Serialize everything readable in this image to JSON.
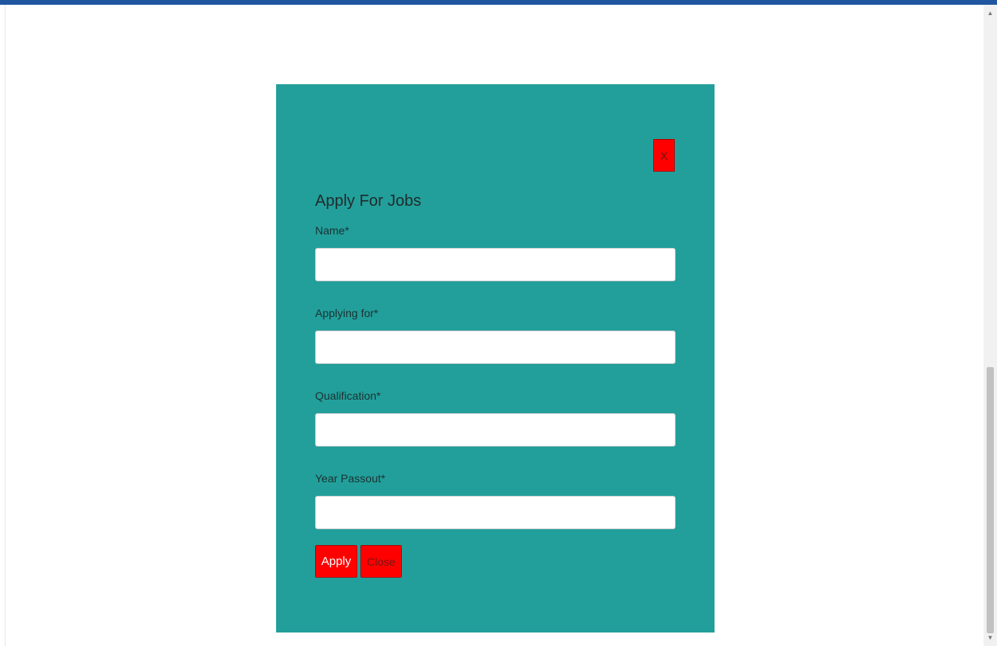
{
  "modal": {
    "close_icon_label": "X",
    "title": "Apply For Jobs",
    "fields": [
      {
        "label": "Name*",
        "value": "",
        "placeholder": ""
      },
      {
        "label": "Applying for*",
        "value": "",
        "placeholder": ""
      },
      {
        "label": "Qualification*",
        "value": "",
        "placeholder": ""
      },
      {
        "label": "Year Passout*",
        "value": "",
        "placeholder": ""
      }
    ],
    "apply_label": "Apply",
    "close_label": "Close"
  },
  "colors": {
    "top_bar": "#1e56a0",
    "modal_background": "#229f9b",
    "button_red": "#ff0000"
  },
  "scrollbar": {
    "up_icon": "scroll-up-arrow-icon",
    "down_icon": "scroll-down-arrow-icon"
  }
}
